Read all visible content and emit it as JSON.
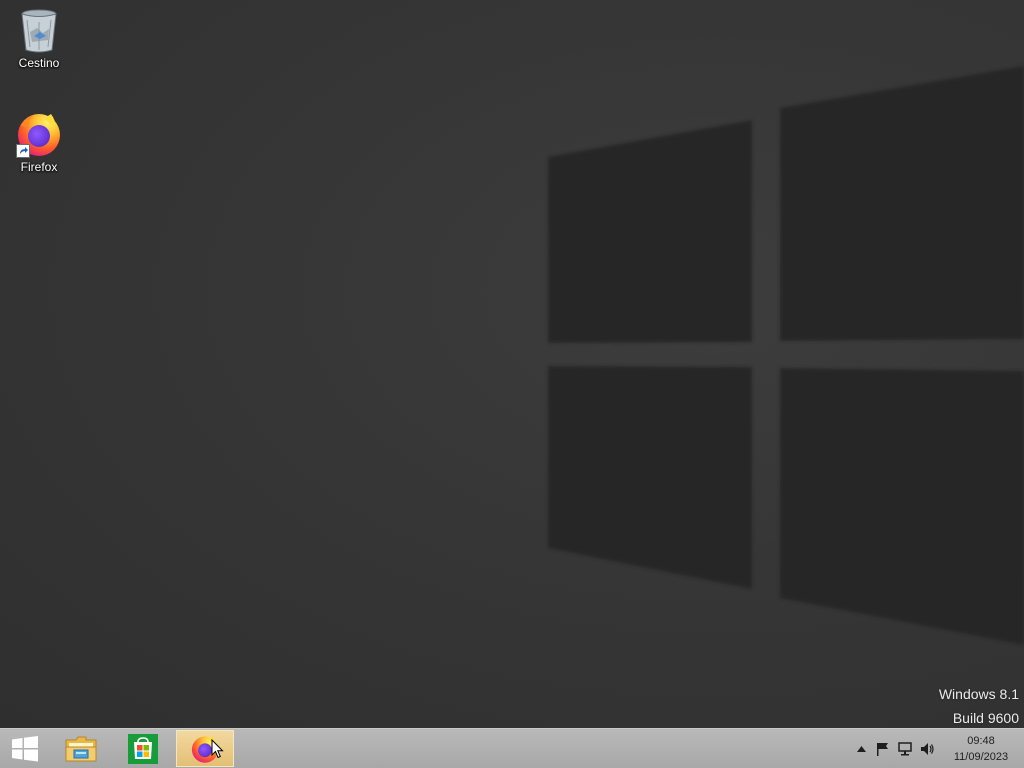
{
  "desktop": {
    "icons": [
      {
        "label": "Cestino",
        "icon": "recycle-bin-icon"
      },
      {
        "label": "Firefox",
        "icon": "firefox-icon"
      }
    ],
    "watermark": {
      "line1": "Windows 8.1",
      "line2": "Build 9600"
    }
  },
  "taskbar": {
    "buttons": [
      {
        "icon": "windows-start-icon",
        "active": false
      },
      {
        "icon": "file-explorer-icon",
        "active": false
      },
      {
        "icon": "store-icon",
        "active": false
      },
      {
        "icon": "firefox-icon",
        "active": true
      }
    ],
    "tray": {
      "icons": [
        "show-hidden-icons-arrow",
        "action-center-flag-icon",
        "network-icon",
        "volume-icon"
      ],
      "time": "09:48",
      "date": "11/09/2023"
    }
  },
  "colors": {
    "wallpaper": "#363636",
    "taskbar": "#b0b0b0",
    "active_button": "#e8c47c",
    "store_green": "#169c3a"
  }
}
